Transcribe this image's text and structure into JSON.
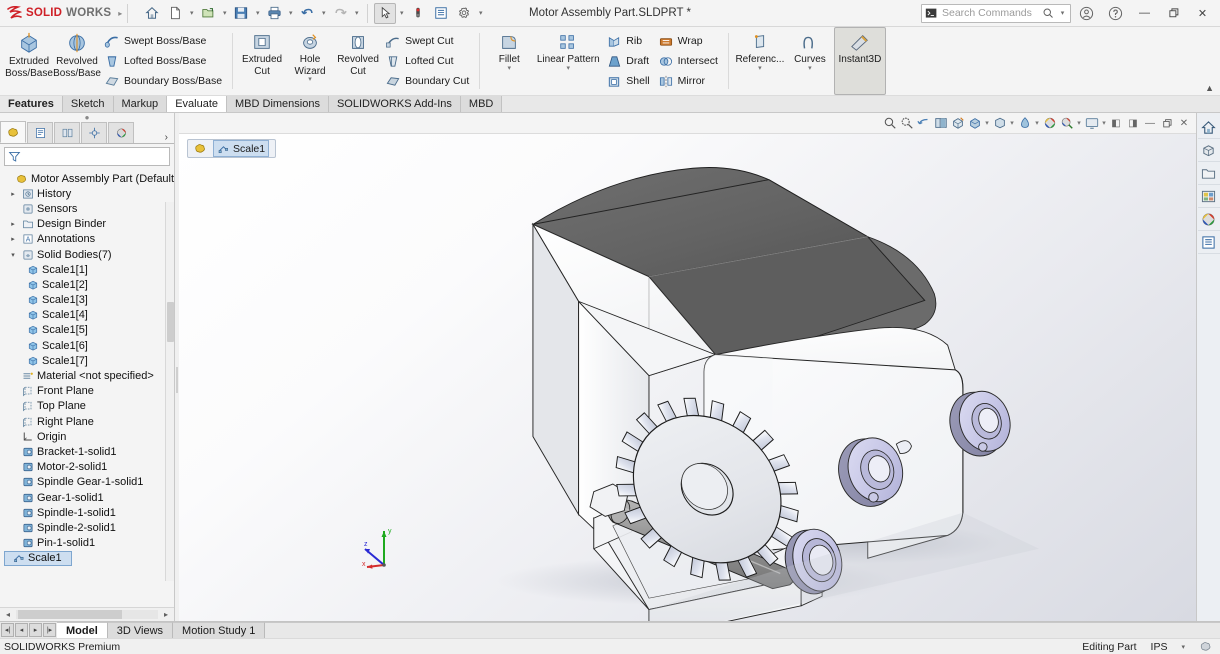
{
  "titlebar": {
    "brand_ds": "DS",
    "brand_solid": "SOLID",
    "brand_works": "WORKS",
    "document_title": "Motor Assembly Part.SLDPRT *",
    "quick_access": [
      {
        "name": "home-icon",
        "label": "Home"
      },
      {
        "name": "new-file-icon",
        "label": "New"
      },
      {
        "name": "open-folder-icon",
        "label": "Open"
      },
      {
        "name": "save-icon",
        "label": "Save"
      },
      {
        "name": "print-icon",
        "label": "Print"
      },
      {
        "name": "undo-icon",
        "label": "Undo"
      },
      {
        "name": "redo-icon",
        "label": "Redo"
      },
      {
        "name": "select-cursor-icon",
        "label": "Select"
      },
      {
        "name": "rebuild-icon",
        "label": "Rebuild"
      },
      {
        "name": "options-list-icon",
        "label": "File Properties"
      },
      {
        "name": "gear-icon",
        "label": "Options"
      }
    ],
    "search": {
      "placeholder": "Search Commands"
    },
    "account_icon": "account-icon",
    "help_icon": "help-icon",
    "window_buttons": {
      "minimize": "—",
      "restore": "❐",
      "close": "✕"
    }
  },
  "ribbon": {
    "groups": [
      {
        "name": "boss-base-group",
        "big": [
          {
            "label": "Extruded\nBoss/Base",
            "icon": "extruded-boss-icon",
            "dropdown": false
          },
          {
            "label": "Revolved\nBoss/Base",
            "icon": "revolved-boss-icon",
            "dropdown": false
          }
        ],
        "small": [
          {
            "label": "Swept Boss/Base",
            "icon": "swept-boss-icon"
          },
          {
            "label": "Lofted Boss/Base",
            "icon": "lofted-boss-icon"
          },
          {
            "label": "Boundary Boss/Base",
            "icon": "boundary-boss-icon"
          }
        ]
      },
      {
        "name": "cut-group",
        "big": [
          {
            "label": "Extruded\nCut",
            "icon": "extruded-cut-icon",
            "dropdown": false
          },
          {
            "label": "Hole Wizard",
            "icon": "hole-wizard-icon",
            "dropdown": true
          },
          {
            "label": "Revolved\nCut",
            "icon": "revolved-cut-icon",
            "dropdown": false
          }
        ],
        "small": [
          {
            "label": "Swept Cut",
            "icon": "swept-cut-icon"
          },
          {
            "label": "Lofted Cut",
            "icon": "lofted-cut-icon"
          },
          {
            "label": "Boundary Cut",
            "icon": "boundary-cut-icon"
          }
        ]
      },
      {
        "name": "feature-group",
        "big": [
          {
            "label": "Fillet",
            "icon": "fillet-icon",
            "dropdown": true
          },
          {
            "label": "Linear Pattern",
            "icon": "linear-pattern-icon",
            "dropdown": true
          }
        ],
        "small": [
          {
            "label": "Rib",
            "icon": "rib-icon"
          },
          {
            "label": "Draft",
            "icon": "draft-icon"
          },
          {
            "label": "Shell",
            "icon": "shell-icon"
          }
        ],
        "small2": [
          {
            "label": "Wrap",
            "icon": "wrap-icon"
          },
          {
            "label": "Intersect",
            "icon": "intersect-icon"
          },
          {
            "label": "Mirror",
            "icon": "mirror-icon"
          }
        ]
      },
      {
        "name": "reference-group",
        "big": [
          {
            "label": "Referenc...",
            "icon": "reference-geometry-icon",
            "dropdown": true
          },
          {
            "label": "Curves",
            "icon": "curves-icon",
            "dropdown": true
          },
          {
            "label": "Instant3D",
            "icon": "instant3d-icon",
            "dropdown": false,
            "selected": true
          }
        ]
      }
    ],
    "pin": "▲"
  },
  "tabs": [
    {
      "label": "Features",
      "state": "active"
    },
    {
      "label": "Sketch",
      "state": "normal"
    },
    {
      "label": "Markup",
      "state": "normal"
    },
    {
      "label": "Evaluate",
      "state": "white"
    },
    {
      "label": "MBD Dimensions",
      "state": "normal"
    },
    {
      "label": "SOLIDWORKS Add-Ins",
      "state": "normal"
    },
    {
      "label": "MBD",
      "state": "normal"
    }
  ],
  "left_panel": {
    "panel_tabs": [
      {
        "name": "feature-manager-tab",
        "active": true
      },
      {
        "name": "property-manager-tab",
        "active": false
      },
      {
        "name": "configuration-manager-tab",
        "active": false
      },
      {
        "name": "dimxpert-manager-tab",
        "active": false
      },
      {
        "name": "display-manager-tab",
        "active": false
      }
    ],
    "more_arrow": "›",
    "filter": {
      "placeholder": "",
      "icon": "filter-icon"
    },
    "tree": [
      {
        "label": "Motor Assembly Part  (Default<<Def",
        "icon": "part-icon",
        "indent": 0,
        "arrow": "",
        "selected": false
      },
      {
        "label": "History",
        "icon": "history-icon",
        "indent": 1,
        "arrow": "▸",
        "selected": false
      },
      {
        "label": "Sensors",
        "icon": "sensors-icon",
        "indent": 1,
        "arrow": "",
        "selected": false
      },
      {
        "label": "Design Binder",
        "icon": "design-binder-icon",
        "indent": 1,
        "arrow": "▸",
        "selected": false
      },
      {
        "label": "Annotations",
        "icon": "annotations-icon",
        "indent": 1,
        "arrow": "▸",
        "selected": false
      },
      {
        "label": "Solid Bodies(7)",
        "icon": "solid-bodies-icon",
        "indent": 1,
        "arrow": "▾",
        "selected": false
      },
      {
        "label": "Scale1[1]",
        "icon": "body-icon",
        "indent": 2,
        "arrow": "",
        "selected": false
      },
      {
        "label": "Scale1[2]",
        "icon": "body-icon",
        "indent": 2,
        "arrow": "",
        "selected": false
      },
      {
        "label": "Scale1[3]",
        "icon": "body-icon",
        "indent": 2,
        "arrow": "",
        "selected": false
      },
      {
        "label": "Scale1[4]",
        "icon": "body-icon",
        "indent": 2,
        "arrow": "",
        "selected": false
      },
      {
        "label": "Scale1[5]",
        "icon": "body-icon",
        "indent": 2,
        "arrow": "",
        "selected": false
      },
      {
        "label": "Scale1[6]",
        "icon": "body-icon",
        "indent": 2,
        "arrow": "",
        "selected": false
      },
      {
        "label": "Scale1[7]",
        "icon": "body-icon",
        "indent": 2,
        "arrow": "",
        "selected": false
      },
      {
        "label": "Material <not specified>",
        "icon": "material-icon",
        "indent": 1,
        "arrow": "",
        "selected": false
      },
      {
        "label": "Front Plane",
        "icon": "plane-icon",
        "indent": 1,
        "arrow": "",
        "selected": false
      },
      {
        "label": "Top Plane",
        "icon": "plane-icon",
        "indent": 1,
        "arrow": "",
        "selected": false
      },
      {
        "label": "Right Plane",
        "icon": "plane-icon",
        "indent": 1,
        "arrow": "",
        "selected": false
      },
      {
        "label": "Origin",
        "icon": "origin-icon",
        "indent": 1,
        "arrow": "",
        "selected": false
      },
      {
        "label": "Bracket-1-solid1",
        "icon": "imported-body-icon",
        "indent": 1,
        "arrow": "",
        "selected": false
      },
      {
        "label": "Motor-2-solid1",
        "icon": "imported-body-icon",
        "indent": 1,
        "arrow": "",
        "selected": false
      },
      {
        "label": "Spindle Gear-1-solid1",
        "icon": "imported-body-icon",
        "indent": 1,
        "arrow": "",
        "selected": false
      },
      {
        "label": "Gear-1-solid1",
        "icon": "imported-body-icon",
        "indent": 1,
        "arrow": "",
        "selected": false
      },
      {
        "label": "Spindle-1-solid1",
        "icon": "imported-body-icon",
        "indent": 1,
        "arrow": "",
        "selected": false
      },
      {
        "label": "Spindle-2-solid1",
        "icon": "imported-body-icon",
        "indent": 1,
        "arrow": "",
        "selected": false
      },
      {
        "label": "Pin-1-solid1",
        "icon": "imported-body-icon",
        "indent": 1,
        "arrow": "",
        "selected": false
      },
      {
        "label": "Scale1",
        "icon": "scale-icon",
        "indent": 1,
        "arrow": "",
        "selected": true
      }
    ],
    "hscroll": {
      "left_arrow": "◂",
      "right_arrow": "▸"
    }
  },
  "viewport": {
    "toolbar": [
      {
        "name": "zoom-to-fit-icon",
        "caret": false
      },
      {
        "name": "zoom-to-area-icon",
        "caret": false
      },
      {
        "name": "previous-view-icon",
        "caret": false
      },
      {
        "name": "section-view-icon",
        "caret": false
      },
      {
        "name": "view-orientation-icon",
        "caret": false
      },
      {
        "name": "display-style-icon",
        "caret": true
      },
      {
        "name": "hide-show-items-icon",
        "caret": true
      },
      {
        "name": "edit-appearance-icon",
        "caret": true
      },
      {
        "name": "apply-scene-icon",
        "caret": false
      },
      {
        "name": "view-settings-icon",
        "caret": true
      },
      {
        "name": "viewport-layout-icon",
        "caret": true
      }
    ],
    "window_controls": [
      {
        "name": "tile-left-icon",
        "glyph": "◧"
      },
      {
        "name": "tile-right-icon",
        "glyph": "◨"
      },
      {
        "name": "minimize-doc-icon",
        "glyph": "—"
      },
      {
        "name": "restore-doc-icon",
        "glyph": "❐"
      },
      {
        "name": "close-doc-icon",
        "glyph": "✕"
      }
    ],
    "breadcrumb": {
      "part_icon": "part-icon",
      "feature_icon": "scale-icon",
      "feature_label": "Scale1"
    },
    "triad": {
      "x_label": "x",
      "y_label": "y",
      "z_label": "z",
      "x_color": "#d42c2c",
      "y_color": "#1faa1f",
      "z_color": "#2a2ad4"
    },
    "model": {
      "bracket_color": "#e8e9ec",
      "motor_body_color": "#fdfdfd",
      "motor_top_color": "#636363",
      "gear_color": "#e4e6ea",
      "spindle_color": "#c9c9e8",
      "roller_color": "#8f8f8f",
      "edge_color": "#222222"
    }
  },
  "task_pane": [
    {
      "name": "solidworks-resources-icon",
      "glyph": "home"
    },
    {
      "name": "design-library-icon",
      "glyph": "box"
    },
    {
      "name": "file-explorer-icon",
      "glyph": "folder"
    },
    {
      "name": "view-palette-icon",
      "glyph": "palette"
    },
    {
      "name": "appearances-scenes-icon",
      "glyph": "sphere"
    },
    {
      "name": "custom-properties-icon",
      "glyph": "list"
    }
  ],
  "bottom": {
    "nav_buttons": [
      "⧏❘",
      "◂",
      "▸",
      "❘⧐"
    ],
    "tabs": [
      {
        "label": "Model",
        "active": true
      },
      {
        "label": "3D Views",
        "active": false
      },
      {
        "label": "Motion Study 1",
        "active": false
      }
    ]
  },
  "statusbar": {
    "left": "SOLIDWORKS Premium",
    "editing": "Editing Part",
    "units": "IPS",
    "units_caret": "▾",
    "tail_icon": "customize-status-icon"
  }
}
